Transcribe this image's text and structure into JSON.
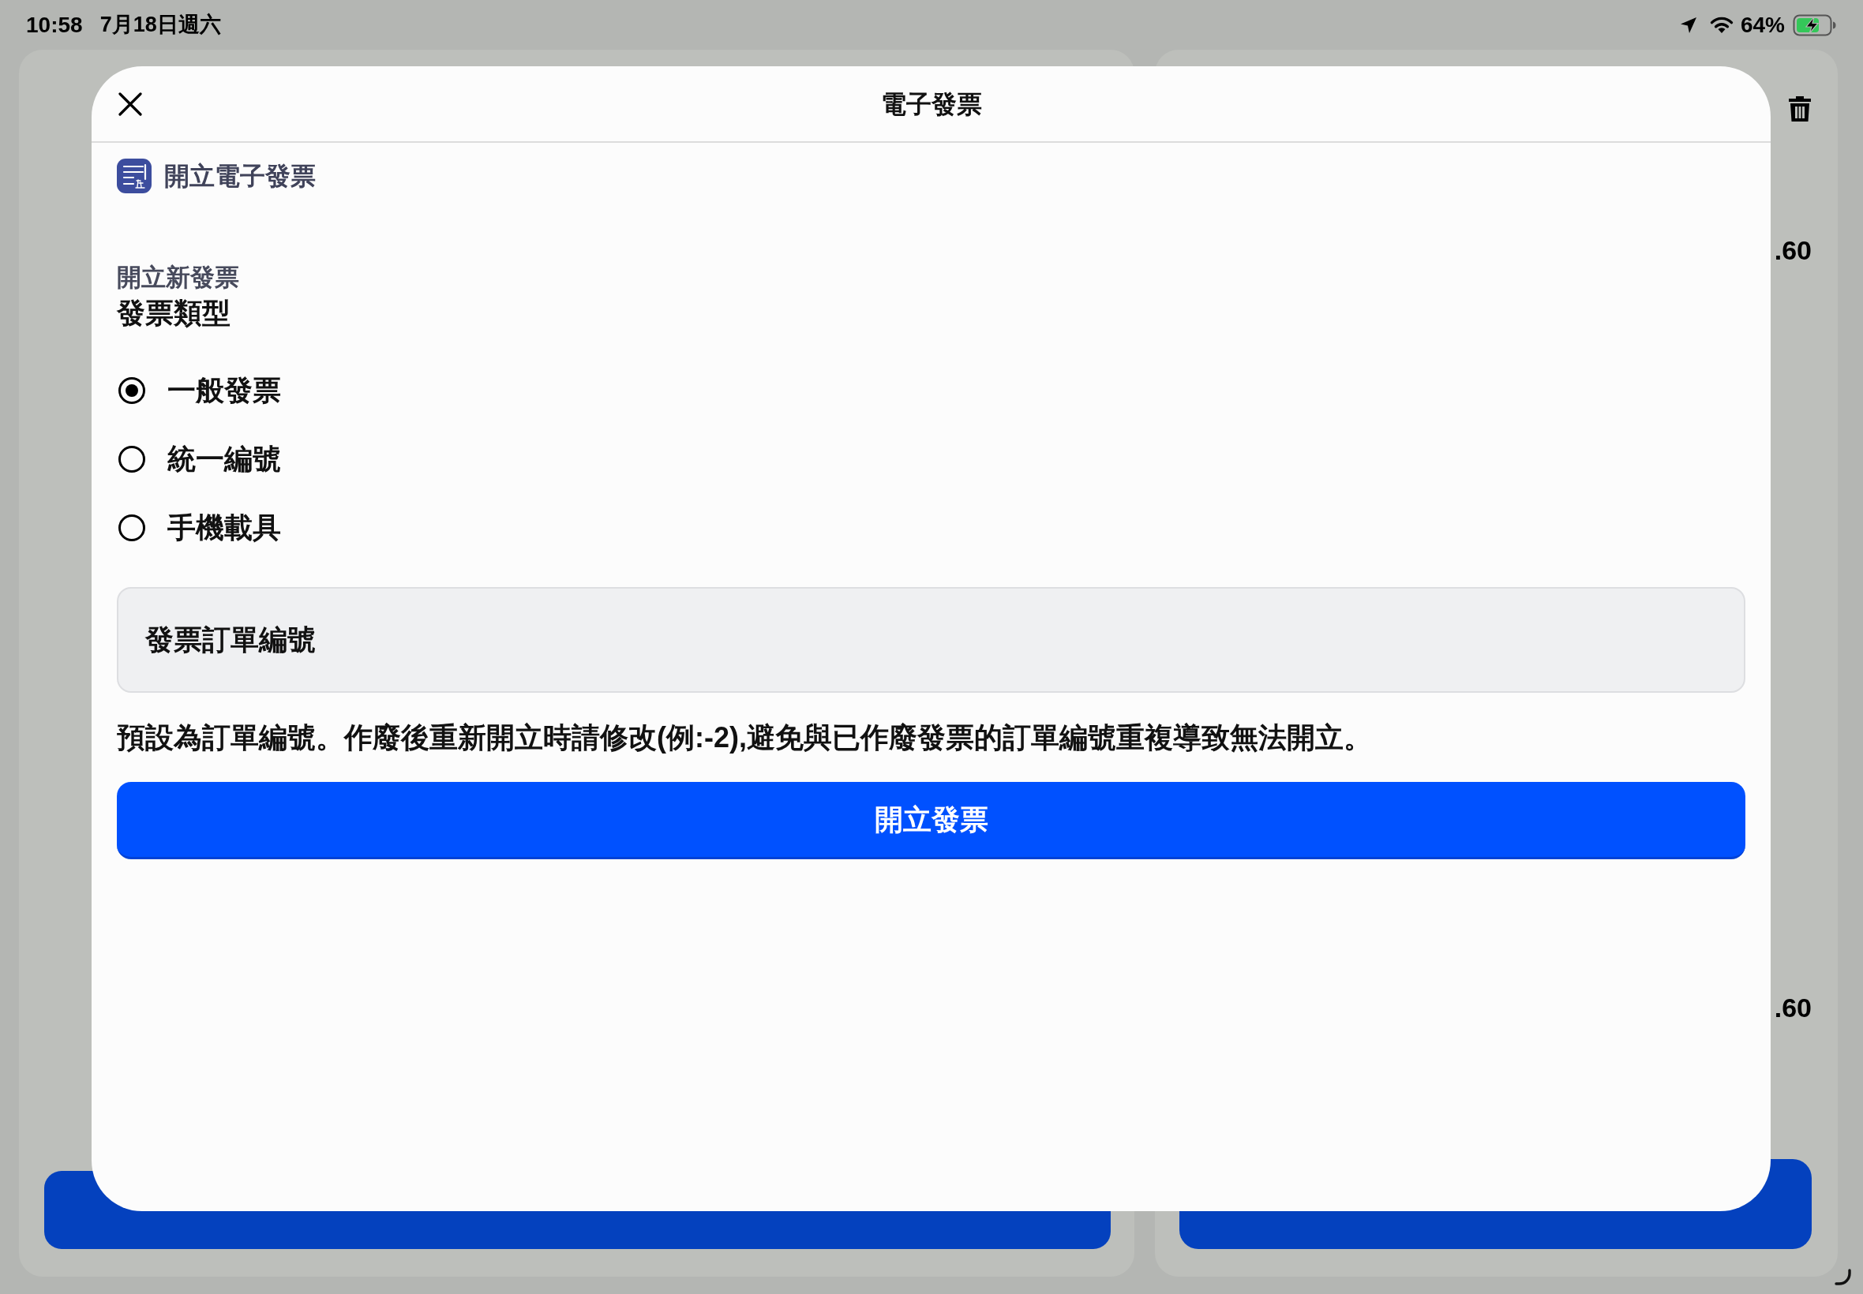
{
  "status_bar": {
    "time": "10:58",
    "date": "7月18日週六",
    "battery_percent": "64%"
  },
  "background": {
    "right_panel": {
      "amounts": [
        ".60",
        ".60"
      ]
    }
  },
  "dialog": {
    "title": "電子發票",
    "section_title": "開立電子發票",
    "subtitle": "開立新發票",
    "group_label": "發票類型",
    "options": [
      {
        "label": "一般發票",
        "selected": true
      },
      {
        "label": "統一編號",
        "selected": false
      },
      {
        "label": "手機載具",
        "selected": false
      }
    ],
    "order_number_field": {
      "label": "發票訂單編號"
    },
    "hint": "預設為訂單編號。作廢後重新開立時請修改(例:-2),避免與已作廢發票的訂單編號重複導致無法開立。",
    "submit_button": "開立發票"
  }
}
